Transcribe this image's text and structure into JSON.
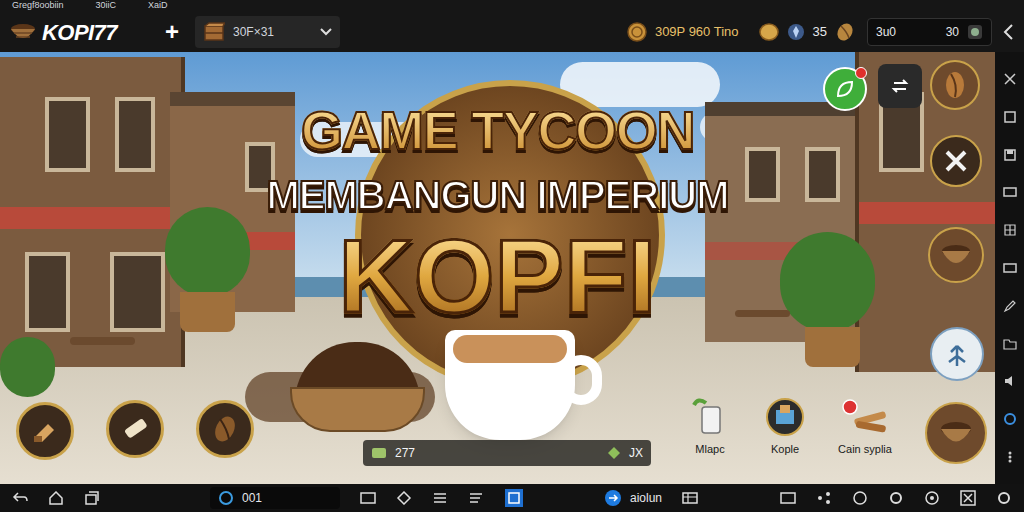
{
  "status_bar": [
    "Gregf8oobiin",
    "30iiC",
    "XaiD"
  ],
  "top_bar": {
    "logo": "KOPI77",
    "add_button": "+",
    "resource": "30F×31",
    "stats": [
      "309P 960 Tino",
      "35"
    ],
    "field_label": "3u0",
    "field_value": "30"
  },
  "title": {
    "line1": "GAME TYCOON",
    "line2": "MEMBANGUN IMPERIUM",
    "line3": "KOPFI"
  },
  "counter": {
    "left": "277",
    "right": "JX"
  },
  "shop_items": [
    {
      "label": "Mlapc"
    },
    {
      "label": "Kople"
    },
    {
      "label": "Cain syplia"
    }
  ],
  "nav_bar": {
    "field": "001",
    "label": "aiolun"
  }
}
